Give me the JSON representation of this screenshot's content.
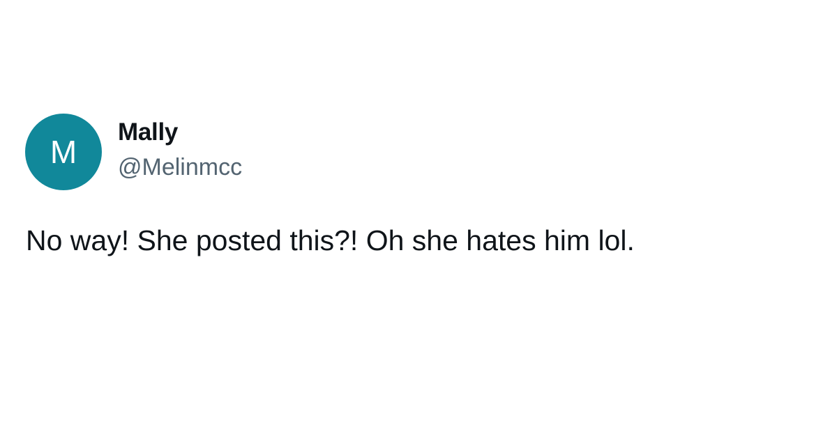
{
  "colors": {
    "avatar_bg": "#11889a",
    "avatar_text": "#ffffff",
    "name_text": "#0f1419",
    "handle_text": "#536471",
    "body_text": "#0f1419",
    "background": "#ffffff"
  },
  "tweet": {
    "avatar_initial": "M",
    "display_name": "Mally",
    "handle": "@Melinmcc",
    "text": "No way! She posted this?! Oh she hates him lol."
  }
}
